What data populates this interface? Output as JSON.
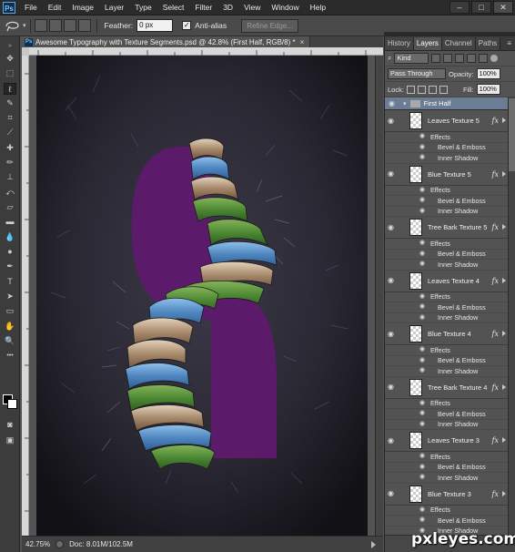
{
  "app": {
    "logo": "Ps"
  },
  "menu": [
    "File",
    "Edit",
    "Image",
    "Layer",
    "Type",
    "Select",
    "Filter",
    "3D",
    "View",
    "Window",
    "Help"
  ],
  "window_controls": {
    "minimize": "–",
    "maximize": "□",
    "close": "✕"
  },
  "options_bar": {
    "feather_label": "Feather:",
    "feather_value": "0 px",
    "antialias_label": "Anti-alias",
    "antialias_checked": "✓",
    "refine_edge_label": "Refine Edge..."
  },
  "document": {
    "tab_title": "Awesome Typography with Texture Segments.psd @ 42.8% (First Half, RGB/8) *",
    "close": "×",
    "zoom": "42.75%",
    "doc_size": "Doc: 8.01M/102.5M"
  },
  "panel": {
    "tabs": [
      "History",
      "Layers",
      "Channel",
      "Paths"
    ],
    "active_tab": "Layers",
    "menu_icon": "≡",
    "filter_kind": "Kind",
    "blend_mode": "Pass Through",
    "opacity_label": "Opacity:",
    "opacity_value": "100%",
    "lock_label": "Lock:",
    "fill_label": "Fill:",
    "fill_value": "100%",
    "group_name": "First Half",
    "layers": [
      {
        "name": "Leaves Texture 5",
        "fx": "fx",
        "effects_label": "Effects",
        "effects": [
          "Bevel & Emboss",
          "Inner Shadow"
        ]
      },
      {
        "name": "Blue Texture 5",
        "fx": "fx",
        "effects_label": "Effects",
        "effects": [
          "Bevel & Emboss",
          "Inner Shadow"
        ]
      },
      {
        "name": "Tree Bark Texture 5",
        "fx": "fx",
        "effects_label": "Effects",
        "effects": [
          "Bevel & Emboss",
          "Inner Shadow"
        ]
      },
      {
        "name": "Leaves Texture 4",
        "fx": "fx",
        "effects_label": "Effects",
        "effects": [
          "Bevel & Emboss",
          "Inner Shadow"
        ]
      },
      {
        "name": "Blue Texture 4",
        "fx": "fx",
        "effects_label": "Effects",
        "effects": [
          "Bevel & Emboss",
          "Inner Shadow"
        ]
      },
      {
        "name": "Tree Bark Texture 4",
        "fx": "fx",
        "effects_label": "Effects",
        "effects": [
          "Bevel & Emboss",
          "Inner Shadow"
        ]
      },
      {
        "name": "Leaves Texture 3",
        "fx": "fx",
        "effects_label": "Effects",
        "effects": [
          "Bevel & Emboss",
          "Inner Shadow"
        ]
      },
      {
        "name": "Blue Texture 3",
        "fx": "fx",
        "effects_label": "Effects",
        "effects": [
          "Bevel & Emboss",
          "Inner Shadow"
        ]
      }
    ]
  },
  "colors": {
    "canvas_bg": "#2b2a33",
    "letter_purple": "#5c1a6b",
    "leaves_green": "#5a8f3a",
    "blue_texture": "#5b8fc7",
    "bark_brown": "#a08468",
    "group_highlight": "#6a7d95"
  },
  "icons": {
    "eye": "eye-icon",
    "folder": "folder-icon",
    "fx": "fx-badge-icon",
    "lock": "lock-icon"
  },
  "watermark": "pxleyes.com"
}
